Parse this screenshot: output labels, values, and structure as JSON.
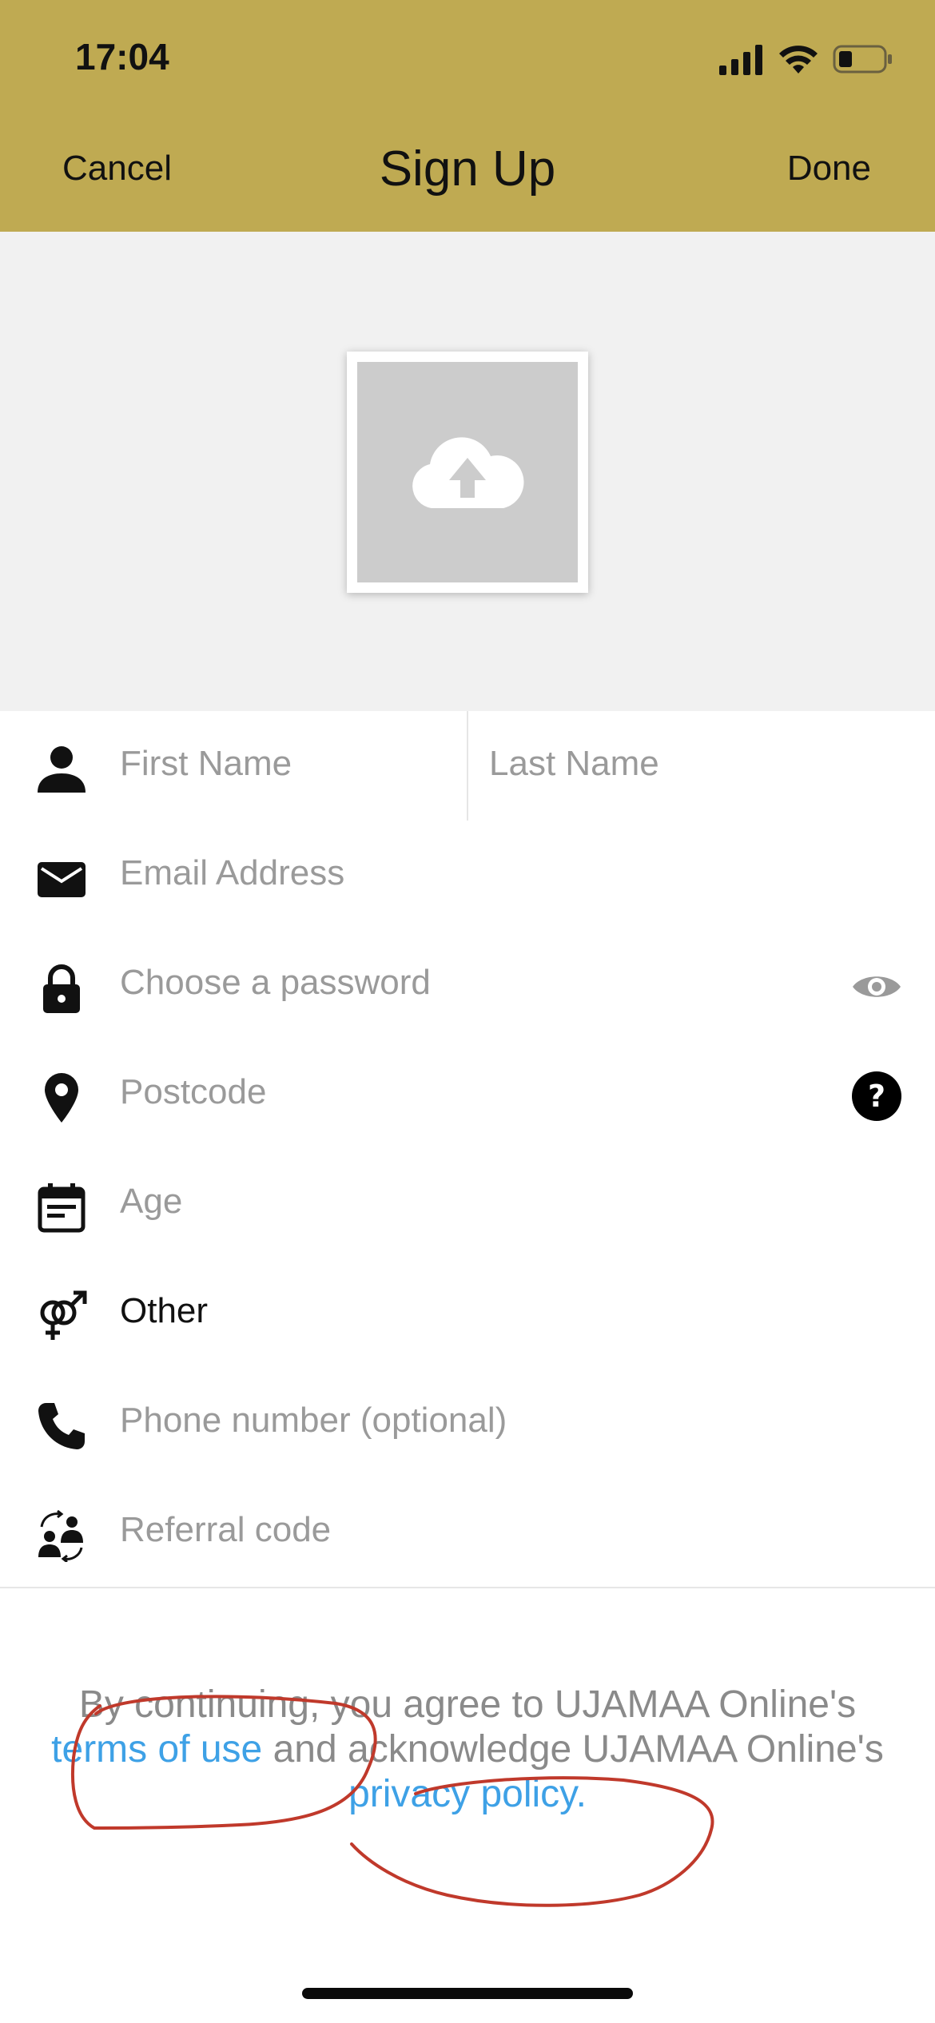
{
  "status": {
    "time": "17:04"
  },
  "nav": {
    "cancel": "Cancel",
    "title": "Sign Up",
    "done": "Done"
  },
  "photo": {
    "icon": "cloud-upload-icon"
  },
  "form": {
    "first_name_placeholder": "First Name",
    "last_name_placeholder": "Last Name",
    "email_placeholder": "Email Address",
    "password_placeholder": "Choose a password",
    "postcode_placeholder": "Postcode",
    "age_placeholder": "Age",
    "gender_value": "Other",
    "phone_placeholder": "Phone number (optional)",
    "referral_placeholder": "Referral code"
  },
  "terms": {
    "prefix": "By continuing, you agree to UJAMAA Online's ",
    "terms_link": "terms of use",
    "middle": " and acknowledge UJAMAA Online's ",
    "privacy_link": "privacy policy."
  },
  "colors": {
    "header": "#bfaa52",
    "link": "#3ea1e6",
    "annotation": "#c0392b"
  }
}
